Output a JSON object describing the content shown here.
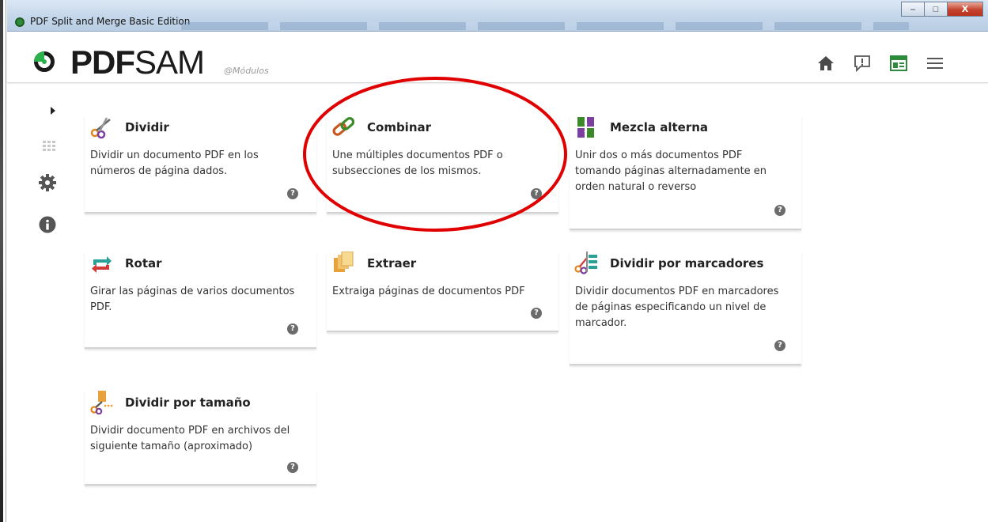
{
  "window": {
    "title": "PDF Split and Merge Basic Edition",
    "buttons": {
      "minimize": "–",
      "maximize": "□",
      "close": "X"
    }
  },
  "header": {
    "brand_pdf": "PDF",
    "brand_sam": "SAM",
    "brand_subtitle": "@Módulos",
    "icons": [
      "home-icon",
      "feedback-icon",
      "dashboard-icon",
      "menu-icon"
    ]
  },
  "sidebar": {
    "items": [
      "expand-arrow-icon",
      "modules-grid-icon",
      "settings-gear-icon",
      "info-icon"
    ]
  },
  "modules": [
    {
      "title": "Dividir",
      "description": "Dividir un documento PDF en los números de página dados.",
      "icon": "scissors-icon"
    },
    {
      "title": "Combinar",
      "description": "Une múltiples documentos PDF o subsecciones de los mismos.",
      "icon": "chain-link-icon"
    },
    {
      "title": "Mezcla alterna",
      "description": "Unir dos o más documentos PDF tomando páginas alternadamente en orden natural o reverso",
      "icon": "alternate-mix-icon"
    },
    {
      "title": "Rotar",
      "description": "Girar las páginas de varios documentos PDF.",
      "icon": "rotate-icon"
    },
    {
      "title": "Extraer",
      "description": "Extraiga páginas de documentos PDF",
      "icon": "extract-pages-icon"
    },
    {
      "title": "Dividir por marcadores",
      "description": "Dividir documentos PDF en marcadores de páginas especificando un nivel de marcador.",
      "icon": "split-bookmarks-icon"
    },
    {
      "title": "Dividir por tamaño",
      "description": "Dividir documento PDF en archivos del siguiente tamaño (aproximado)",
      "icon": "split-size-icon"
    }
  ],
  "help_glyph": "?",
  "colors": {
    "brand_green": "#2bb24c",
    "annotation_red": "#e00000",
    "active_icon": "#2e8b3c"
  }
}
